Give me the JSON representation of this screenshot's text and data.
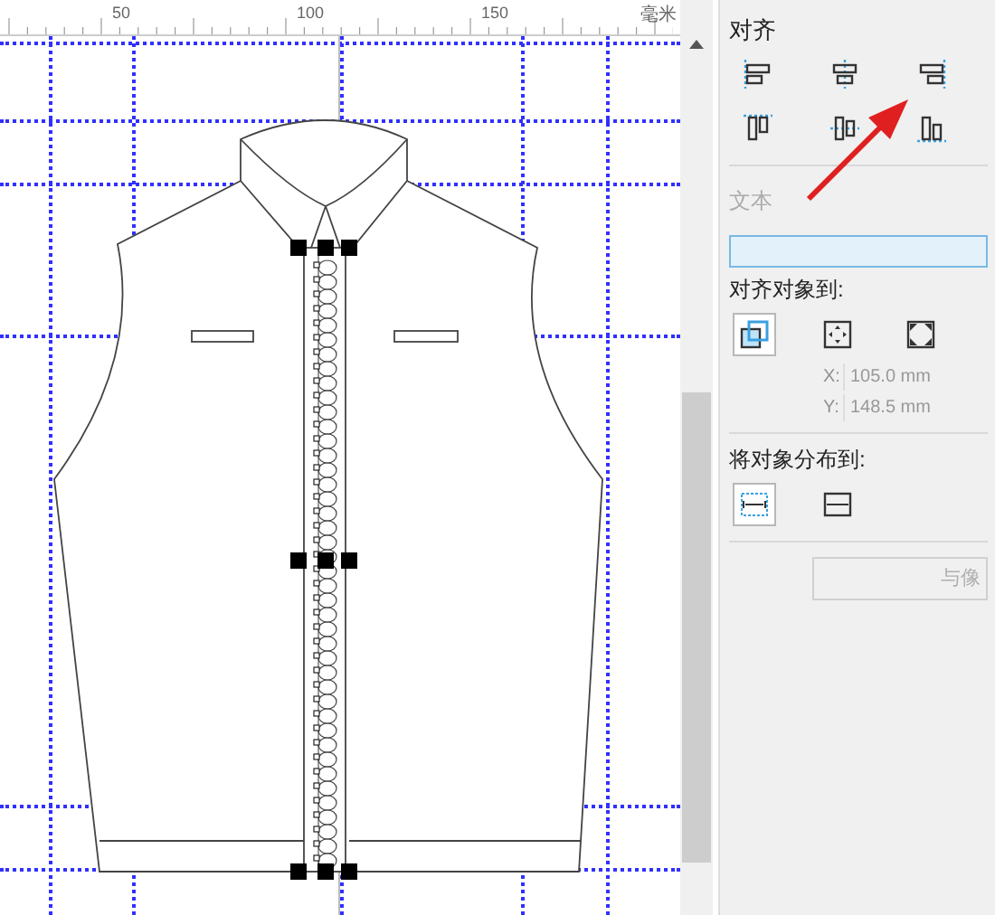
{
  "ruler": {
    "labels": [
      "50",
      "100",
      "150"
    ],
    "unit": "毫米"
  },
  "panel": {
    "title": "对齐",
    "align_buttons": [
      {
        "kind": "left",
        "selected": false
      },
      {
        "kind": "hcenter",
        "selected": false
      },
      {
        "kind": "right",
        "selected": false
      },
      {
        "kind": "top",
        "selected": false
      },
      {
        "kind": "vcenter",
        "selected": false
      },
      {
        "kind": "bottom",
        "selected": false
      }
    ],
    "text_label": {
      "text": "文本",
      "disabled": true
    },
    "align_to": {
      "label": "对齐对象到:",
      "buttons": [
        {
          "kind": "active",
          "selected": true
        },
        {
          "kind": "page-center",
          "selected": false
        },
        {
          "kind": "page-edge",
          "selected": false
        }
      ]
    },
    "coords": [
      {
        "label": "X:",
        "value": "105.0 mm",
        "disabled": true
      },
      {
        "label": "Y:",
        "value": "148.5 mm",
        "disabled": true
      }
    ],
    "distribute_to": {
      "label": "将对象分布到:",
      "buttons": [
        {
          "kind": "selection",
          "selected": true
        },
        {
          "kind": "page",
          "selected": false
        }
      ]
    },
    "bottom_button": {
      "label": "与像",
      "disabled": true
    }
  }
}
